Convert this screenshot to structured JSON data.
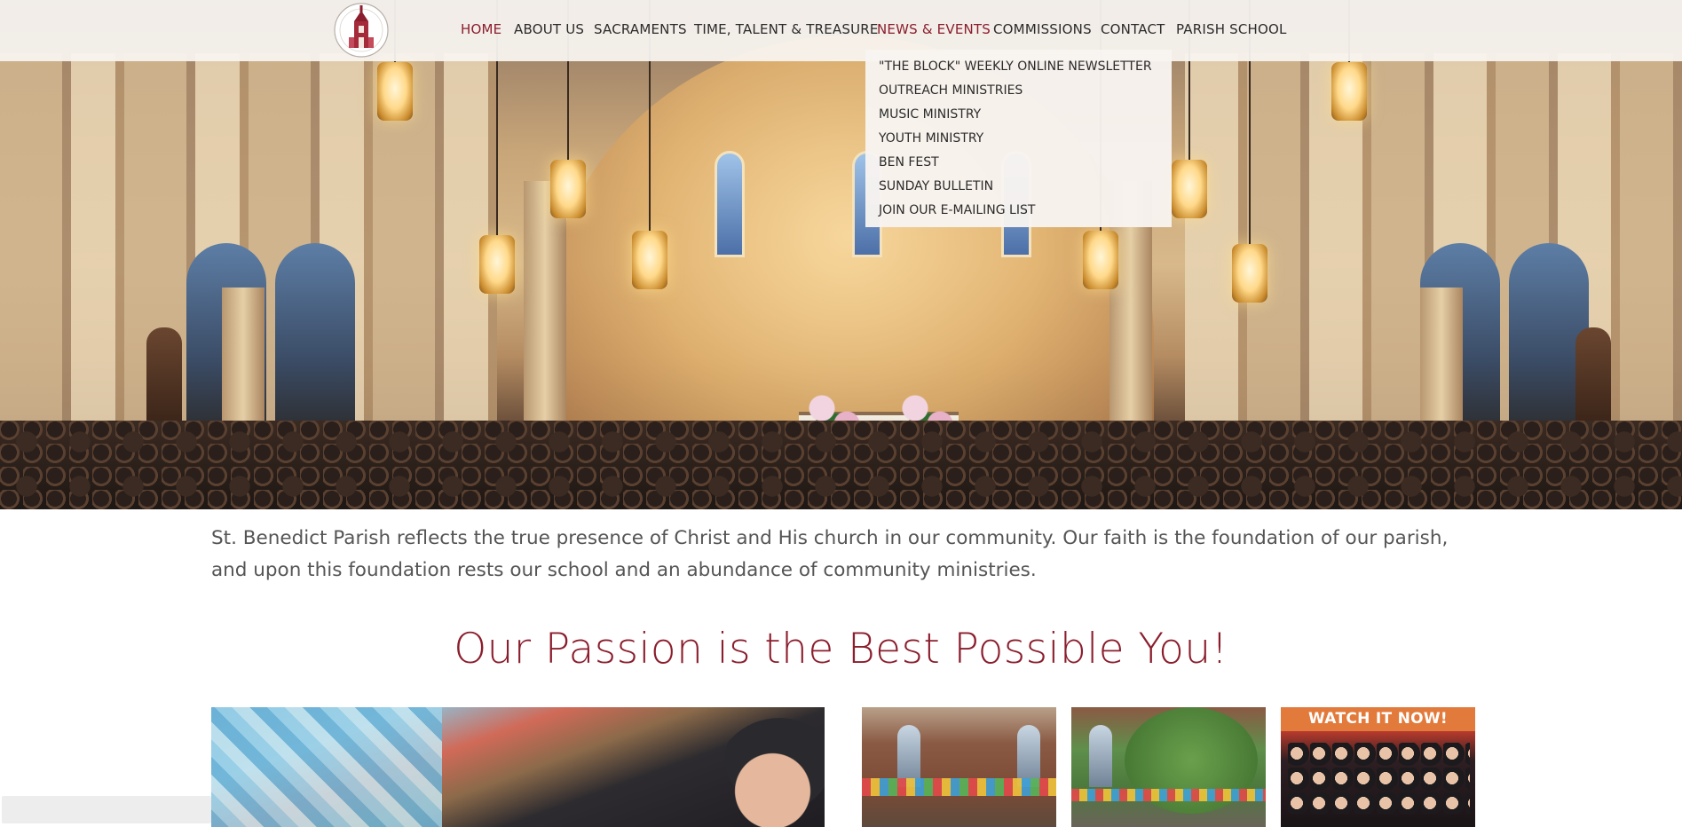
{
  "site": {
    "logo_alt": "St. Benedict"
  },
  "nav": {
    "items": [
      {
        "label": "HOME",
        "active": true
      },
      {
        "label": "ABOUT US",
        "active": false
      },
      {
        "label": "SACRAMENTS",
        "active": false
      },
      {
        "label": "TIME, TALENT & TREASURE",
        "active": false
      },
      {
        "label": "NEWS & EVENTS",
        "active": true
      },
      {
        "label": "COMMISSIONS",
        "active": false
      },
      {
        "label": "CONTACT",
        "active": false
      },
      {
        "label": "PARISH SCHOOL",
        "active": false
      }
    ]
  },
  "dropdown": {
    "items": [
      "\"THE BLOCK\" WEEKLY ONLINE NEWSLETTER",
      "OUTREACH MINISTRIES",
      "MUSIC MINISTRY",
      "YOUTH MINISTRY",
      "BEN FEST",
      "SUNDAY BULLETIN",
      "JOIN OUR E-MAILING LIST"
    ]
  },
  "intro": {
    "text": "St. Benedict Parish reflects the true presence of Christ and His church in our community. Our faith is the foundation of our parish, and upon this foundation rests our school and an abundance of community ministries."
  },
  "headline": {
    "text": "Our Passion is the Best Possible You!"
  },
  "tiles": {
    "watch_banner": "WATCH IT NOW!"
  },
  "colors": {
    "accent": "#8b1e2d",
    "nav_text": "#2b2b2b",
    "banner_orange": "#e27a3c",
    "body_text": "#555555"
  },
  "icons": {
    "logo": "church-tower-seal-icon"
  }
}
